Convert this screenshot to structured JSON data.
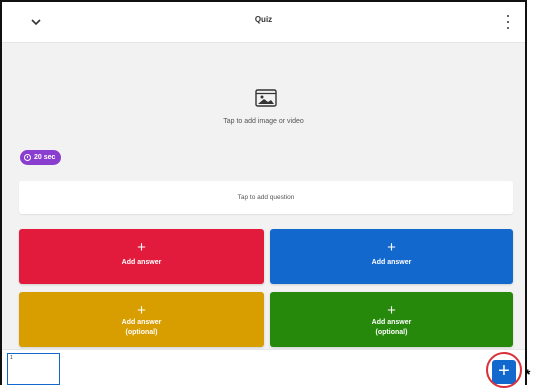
{
  "header": {
    "title": "Quiz"
  },
  "media": {
    "label": "Tap to add image or video"
  },
  "timer": {
    "label": "20 sec"
  },
  "question": {
    "placeholder": "Tap to add question"
  },
  "answers": [
    {
      "label": "Add answer",
      "optional": "",
      "color": "#e21b3c"
    },
    {
      "label": "Add answer",
      "optional": "",
      "color": "#1368ce"
    },
    {
      "label": "Add answer",
      "optional": "(optional)",
      "color": "#d89e00"
    },
    {
      "label": "Add answer",
      "optional": "(optional)",
      "color": "#26890c"
    }
  ],
  "slides": [
    {
      "number": "1"
    }
  ],
  "add_slide": {
    "symbol": "+"
  },
  "plus_symbol": "+",
  "annotation": {
    "symbol": "*"
  },
  "colors": {
    "accent": "#1368ce",
    "timer": "#8a3ecf",
    "background": "#f2f2f2",
    "highlight": "#d9303a"
  }
}
